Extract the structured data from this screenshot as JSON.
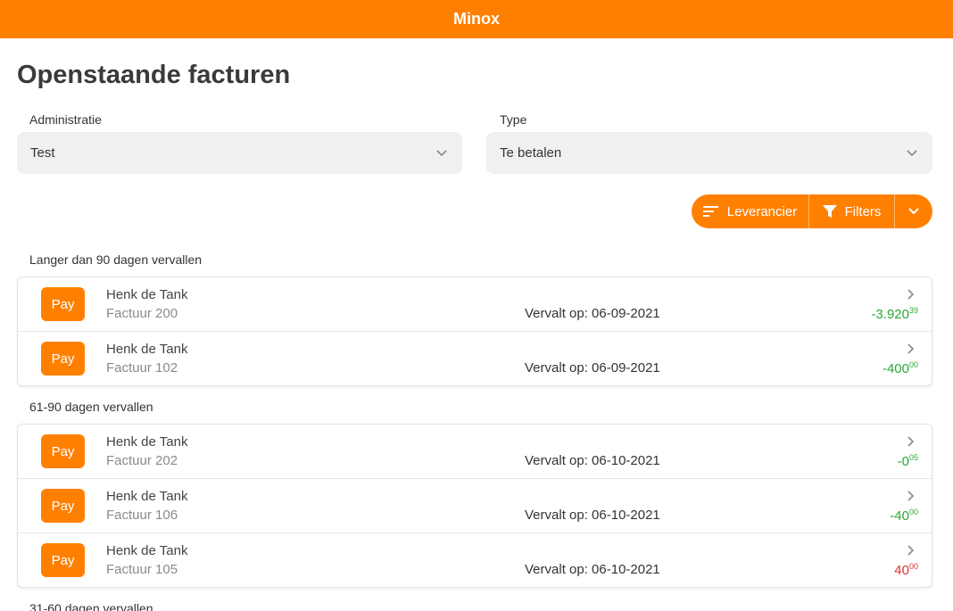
{
  "app": {
    "title": "Minox"
  },
  "page": {
    "title": "Openstaande facturen"
  },
  "filters": {
    "administratie": {
      "label": "Administratie",
      "value": "Test"
    },
    "type": {
      "label": "Type",
      "value": "Te betalen"
    }
  },
  "toolbar": {
    "sort_label": "Leverancier",
    "filters_label": "Filters"
  },
  "colors": {
    "accent": "#ff8000",
    "negative": "#2aa834",
    "positive": "#e03030"
  },
  "groups": [
    {
      "label": "Langer dan 90 dagen vervallen",
      "rows": [
        {
          "pay": "Pay",
          "supplier": "Henk de Tank",
          "invoice": "Factuur 200",
          "due": "Vervalt op: 06-09-2021",
          "amount_main": "-3.920",
          "amount_frac": "39",
          "sign": "neg"
        },
        {
          "pay": "Pay",
          "supplier": "Henk de Tank",
          "invoice": "Factuur 102",
          "due": "Vervalt op: 06-09-2021",
          "amount_main": "-400",
          "amount_frac": "00",
          "sign": "neg"
        }
      ]
    },
    {
      "label": "61-90 dagen vervallen",
      "rows": [
        {
          "pay": "Pay",
          "supplier": "Henk de Tank",
          "invoice": "Factuur 202",
          "due": "Vervalt op: 06-10-2021",
          "amount_main": "-0",
          "amount_frac": "05",
          "sign": "neg"
        },
        {
          "pay": "Pay",
          "supplier": "Henk de Tank",
          "invoice": "Factuur 106",
          "due": "Vervalt op: 06-10-2021",
          "amount_main": "-40",
          "amount_frac": "00",
          "sign": "neg"
        },
        {
          "pay": "Pay",
          "supplier": "Henk de Tank",
          "invoice": "Factuur 105",
          "due": "Vervalt op: 06-10-2021",
          "amount_main": "40",
          "amount_frac": "00",
          "sign": "pos"
        }
      ]
    },
    {
      "label": "31-60 dagen vervallen",
      "rows": []
    }
  ]
}
